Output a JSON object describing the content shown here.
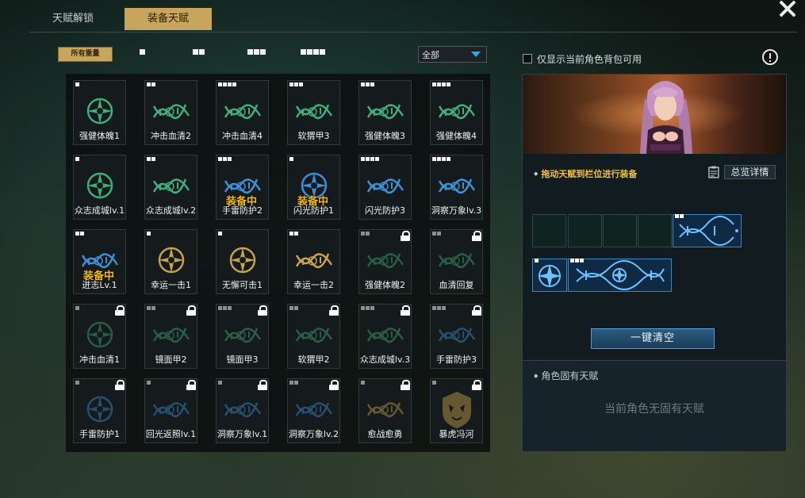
{
  "tabs": {
    "unlock": "天赋解锁",
    "equip": "装备天赋"
  },
  "filters": {
    "all": "所有重量",
    "dropdown_value": "全部"
  },
  "only_bag_label": "仅显示当前角色背包可用",
  "equipped_label": "装备中",
  "talents": [
    {
      "name": "强健体魄1",
      "tier": 1,
      "locked": false,
      "equipped": false,
      "icon": "emblem",
      "color": "#3fae7a"
    },
    {
      "name": "冲击血清2",
      "tier": 2,
      "locked": false,
      "equipped": false,
      "icon": "helix",
      "color": "#3fae7a"
    },
    {
      "name": "冲击血清4",
      "tier": 4,
      "locked": false,
      "equipped": false,
      "icon": "helix",
      "color": "#3fae7a"
    },
    {
      "name": "软猬甲3",
      "tier": 3,
      "locked": false,
      "equipped": false,
      "icon": "helix",
      "color": "#3fae7a"
    },
    {
      "name": "强健体魄3",
      "tier": 3,
      "locked": false,
      "equipped": false,
      "icon": "helix",
      "color": "#3fae7a"
    },
    {
      "name": "强健体魄4",
      "tier": 4,
      "locked": false,
      "equipped": false,
      "icon": "helix",
      "color": "#3fae7a"
    },
    {
      "name": "众志成城lv.1",
      "tier": 1,
      "locked": false,
      "equipped": false,
      "icon": "emblem",
      "color": "#3fae7a"
    },
    {
      "name": "众志成城lv.2",
      "tier": 2,
      "locked": false,
      "equipped": false,
      "icon": "helix",
      "color": "#3fae7a"
    },
    {
      "name": "手雷防护2",
      "tier": 3,
      "locked": false,
      "equipped": true,
      "icon": "helix",
      "color": "#3d8fd6"
    },
    {
      "name": "闪光防护1",
      "tier": 1,
      "locked": false,
      "equipped": true,
      "icon": "emblem",
      "color": "#3d8fd6"
    },
    {
      "name": "闪光防护3",
      "tier": 4,
      "locked": false,
      "equipped": false,
      "icon": "helix",
      "color": "#3d8fd6"
    },
    {
      "name": "洞察万象lv.3",
      "tier": 4,
      "locked": false,
      "equipped": false,
      "icon": "helix",
      "color": "#3d8fd6"
    },
    {
      "name": "迸志Lv.1",
      "tier": 2,
      "locked": false,
      "equipped": true,
      "icon": "helix",
      "color": "#3d8fd6"
    },
    {
      "name": "幸运一击1",
      "tier": 1,
      "locked": false,
      "equipped": false,
      "icon": "emblem",
      "color": "#c8a24a"
    },
    {
      "name": "无懈可击1",
      "tier": 1,
      "locked": false,
      "equipped": false,
      "icon": "emblem",
      "color": "#c8a24a"
    },
    {
      "name": "幸运一击2",
      "tier": 2,
      "locked": false,
      "equipped": false,
      "icon": "helix",
      "color": "#c8a24a"
    },
    {
      "name": "强健体魄2",
      "tier": 2,
      "locked": true,
      "equipped": false,
      "icon": "helix",
      "color": "#3fae7a"
    },
    {
      "name": "血清回复",
      "tier": 2,
      "locked": true,
      "equipped": false,
      "icon": "helix",
      "color": "#3fae7a"
    },
    {
      "name": "冲击血清1",
      "tier": 1,
      "locked": true,
      "equipped": false,
      "icon": "emblem",
      "color": "#3fae7a"
    },
    {
      "name": "镜面甲2",
      "tier": 2,
      "locked": true,
      "equipped": false,
      "icon": "helix",
      "color": "#3fae7a"
    },
    {
      "name": "镜面甲3",
      "tier": 3,
      "locked": true,
      "equipped": false,
      "icon": "helix",
      "color": "#3fae7a"
    },
    {
      "name": "软猬甲2",
      "tier": 2,
      "locked": true,
      "equipped": false,
      "icon": "helix",
      "color": "#3fae7a"
    },
    {
      "name": "众志成城lv.3",
      "tier": 3,
      "locked": true,
      "equipped": false,
      "icon": "helix",
      "color": "#3fae7a"
    },
    {
      "name": "手雷防护3",
      "tier": 3,
      "locked": true,
      "equipped": false,
      "icon": "helix",
      "color": "#3d8fd6"
    },
    {
      "name": "手雷防护1",
      "tier": 1,
      "locked": true,
      "equipped": false,
      "icon": "emblem",
      "color": "#3d8fd6"
    },
    {
      "name": "回光返照lv.1",
      "tier": 1,
      "locked": true,
      "equipped": false,
      "icon": "helix",
      "color": "#3d8fd6"
    },
    {
      "name": "洞察万象lv.1",
      "tier": 1,
      "locked": true,
      "equipped": false,
      "icon": "helix",
      "color": "#3d8fd6"
    },
    {
      "name": "洞察万象lv.2",
      "tier": 2,
      "locked": true,
      "equipped": false,
      "icon": "helix",
      "color": "#3d8fd6"
    },
    {
      "name": "愈战愈勇",
      "tier": 1,
      "locked": true,
      "equipped": false,
      "icon": "helix",
      "color": "#c8a24a"
    },
    {
      "name": "暴虎冯河",
      "tier": 1,
      "locked": true,
      "equipped": false,
      "icon": "tiger",
      "color": "#c8a24a"
    }
  ],
  "hint": "拖动天赋到栏位进行装备",
  "overview_label": "总览详情",
  "clear_label": "一键清空",
  "innate_title": "角色固有天赋",
  "innate_empty": "当前角色无固有天赋",
  "equipped_slots": {
    "row1_filled_tier": 2,
    "row2_emblem_tier": 1,
    "row2_helix_tier": 3
  },
  "colors": {
    "gold": "#c8a55c",
    "equipped_text": "#f2b91e",
    "blue": "#3d8fd6",
    "green": "#3fae7a"
  }
}
